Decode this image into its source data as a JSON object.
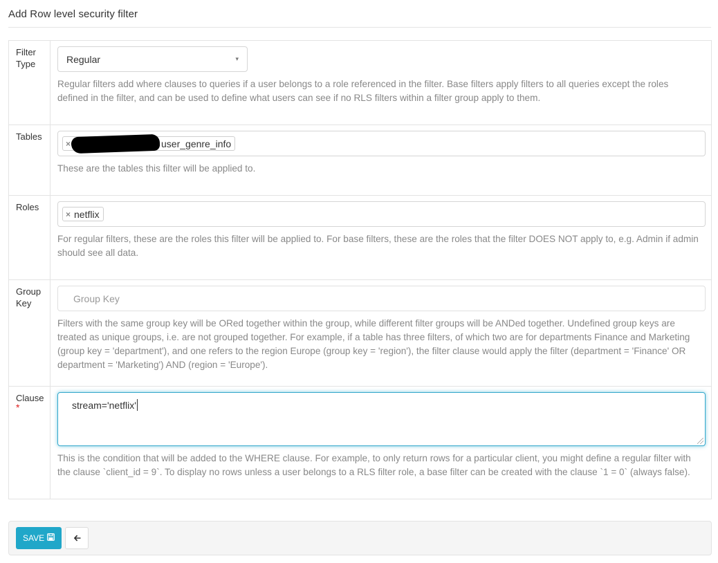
{
  "page": {
    "title": "Add Row level security filter"
  },
  "form": {
    "filter_type": {
      "label": "Filter Type",
      "selected": "Regular",
      "help": "Regular filters add where clauses to queries if a user belongs to a role referenced in the filter. Base filters apply filters to all queries except the roles defined in the filter, and can be used to define what users can see if no RLS filters within a filter group apply to them."
    },
    "tables": {
      "label": "Tables",
      "tags": [
        {
          "remove_glyph": "×",
          "visible_text": "user_genre_info",
          "redacted_prefix": true
        }
      ],
      "help": "These are the tables this filter will be applied to."
    },
    "roles": {
      "label": "Roles",
      "tags": [
        {
          "remove_glyph": "×",
          "visible_text": "netflix"
        }
      ],
      "help": "For regular filters, these are the roles this filter will be applied to. For base filters, these are the roles that the filter DOES NOT apply to, e.g. Admin if admin should see all data."
    },
    "group_key": {
      "label": "Group Key",
      "value": "",
      "placeholder": "Group Key",
      "help": "Filters with the same group key will be ORed together within the group, while different filter groups will be ANDed together. Undefined group keys are treated as unique groups, i.e. are not grouped together. For example, if a table has three filters, of which two are for departments Finance and Marketing (group key = 'department'), and one refers to the region Europe (group key = 'region'), the filter clause would apply the filter (department = 'Finance' OR department = 'Marketing') AND (region = 'Europe')."
    },
    "clause": {
      "label": "Clause",
      "required_mark": "*",
      "value": "stream='netflix'",
      "help": "This is the condition that will be added to the WHERE clause. For example, to only return rows for a particular client, you might define a regular filter with the clause `client_id = 9`. To display no rows unless a user belongs to a RLS filter role, a base filter can be created with the clause `1 = 0` (always false)."
    }
  },
  "actions": {
    "save_label": "SAVE",
    "save_icon": "floppy-disk-icon",
    "back_icon": "arrow-left-icon"
  },
  "colors": {
    "primary": "#20a7c9",
    "required": "#e02020",
    "help_text": "#888888"
  },
  "icons": {
    "caret": "▾",
    "floppy": "🖫",
    "back_arrow": "🡐"
  }
}
